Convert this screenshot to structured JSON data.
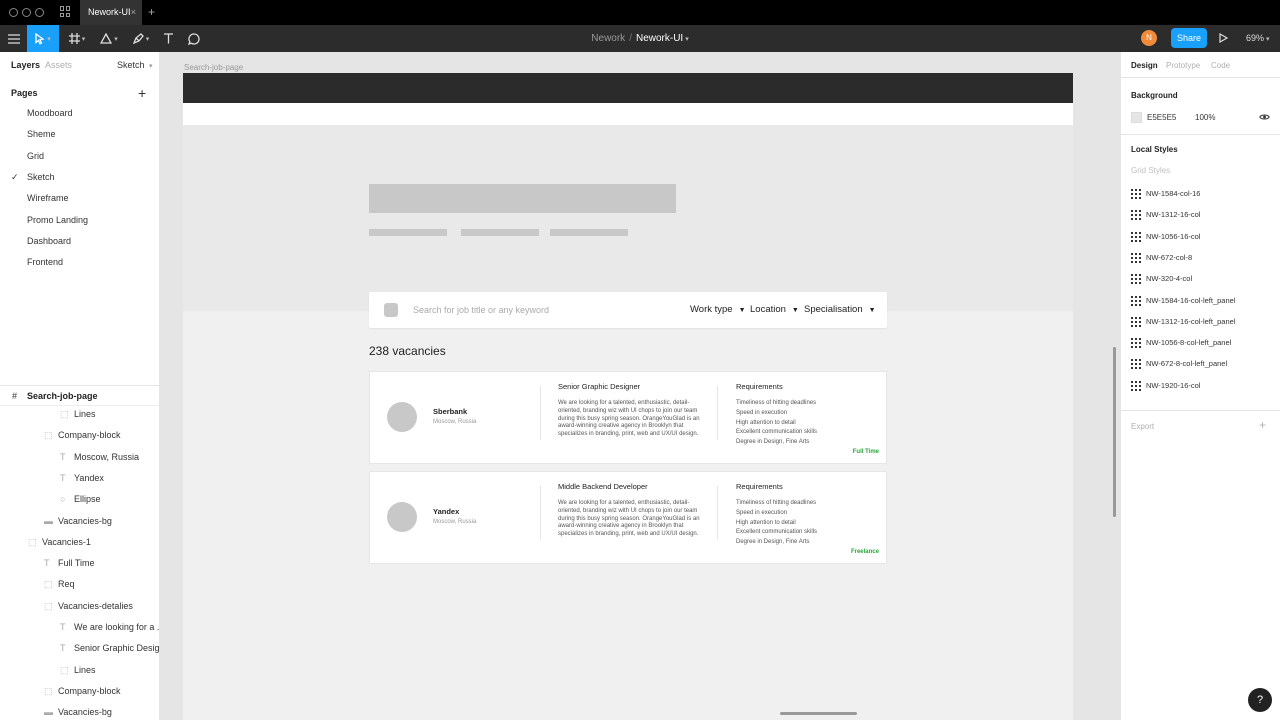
{
  "window": {
    "tab_title": "Nework-UI",
    "tab_close": "×",
    "tab_add": "+"
  },
  "toolbar": {
    "tools": [
      "move-tool",
      "frame-tool",
      "shape-tool",
      "pen-tool",
      "text-tool",
      "comment-tool"
    ],
    "file_path": {
      "team": "Nework",
      "separator": "/",
      "file": "Nework-UI"
    },
    "avatar_initial": "N",
    "share_label": "Share",
    "zoom": "69%",
    "accent_color": "#18a0fb"
  },
  "left_panel": {
    "tabs": {
      "layers": "Layers",
      "assets": "Assets",
      "page_selector": "Sketch"
    },
    "pages_title": "Pages",
    "pages_add": "+",
    "pages": [
      {
        "label": "Moodboard",
        "active": false
      },
      {
        "label": "Sheme",
        "active": false
      },
      {
        "label": "Grid",
        "active": false
      },
      {
        "label": "Sketch",
        "active": true
      },
      {
        "label": "Wireframe",
        "active": false
      },
      {
        "label": "Promo Landing",
        "active": false
      },
      {
        "label": "Dashboard",
        "active": false
      },
      {
        "label": "Frontend",
        "active": false
      }
    ],
    "current_frame": "Search-job-page",
    "layers": [
      {
        "label": "Lines",
        "icon": "group-icon",
        "depth": 3
      },
      {
        "label": "Company-block",
        "icon": "group-icon",
        "depth": 2
      },
      {
        "label": "Moscow, Russia",
        "icon": "text-icon",
        "depth": 3
      },
      {
        "label": "Yandex",
        "icon": "text-icon",
        "depth": 3
      },
      {
        "label": "Ellipse",
        "icon": "ellipse-icon",
        "depth": 3
      },
      {
        "label": "Vacancies-bg",
        "icon": "rectangle-icon",
        "depth": 2
      },
      {
        "label": "Vacancies-1",
        "icon": "group-icon",
        "depth": 1
      },
      {
        "label": "Full Time",
        "icon": "text-icon",
        "depth": 2
      },
      {
        "label": "Req",
        "icon": "group-icon",
        "depth": 2
      },
      {
        "label": "Vacancies-detalies",
        "icon": "group-icon",
        "depth": 2
      },
      {
        "label": "We are looking for a ...",
        "icon": "text-icon",
        "depth": 3
      },
      {
        "label": "Senior Graphic Desig...",
        "icon": "text-icon",
        "depth": 3
      },
      {
        "label": "Lines",
        "icon": "group-icon",
        "depth": 3
      },
      {
        "label": "Company-block",
        "icon": "group-icon",
        "depth": 2
      },
      {
        "label": "Vacancies-bg",
        "icon": "rectangle-icon",
        "depth": 2
      }
    ]
  },
  "canvas": {
    "frame_label": "Search-job-page",
    "search": {
      "placeholder": "Search for job title or any keyword",
      "filters": [
        "Work type",
        "Location",
        "Specialisation"
      ],
      "filter_arrow": "▼"
    },
    "vacancies_count": "238 vacancies",
    "cards": [
      {
        "company": "Sberbank",
        "location": "Moscow, Russia",
        "job_title": "Senior Graphic Designer",
        "description": "We are looking for a talented, enthusiastic, detail-oriented, branding wiz with UI chops to join our team during this busy spring season. OrangeYouGlad is an award-winning creative agency in Brooklyn that specializes in branding, print, web and UX/UI design.",
        "requirements_title": "Requirements",
        "requirements": [
          "Timeliness of hitting deadlines",
          "Speed in execution",
          "High attention to detail",
          "Excellent communication skills",
          "Degree in Design, Fine Arts"
        ],
        "job_type": "Full Time"
      },
      {
        "company": "Yandex",
        "location": "Moscow, Russia",
        "job_title": "Middle Backend Developer",
        "description": "We are looking for a talented, enthusiastic, detail-oriented, branding wiz with UI chops to join our team during this busy spring season. OrangeYouGlad is an award-winning creative agency in Brooklyn that specializes in branding, print, web and UX/UI design.",
        "requirements_title": "Requirements",
        "requirements": [
          "Timeliness of hitting deadlines",
          "Speed in execution",
          "High attention to detail",
          "Excellent communication skills",
          "Degree in Design, Fine Arts"
        ],
        "job_type": "Freelance"
      }
    ],
    "job_type_color": "#2aa63b"
  },
  "right_panel": {
    "tabs": {
      "design": "Design",
      "prototype": "Prototype",
      "code": "Code"
    },
    "background": {
      "title": "Background",
      "hex": "E5E5E5",
      "opacity": "100%",
      "color": "#e5e5e5"
    },
    "local_styles_title": "Local Styles",
    "grid_styles_title": "Grid Styles",
    "grid_styles": [
      "NW-1584-col-16",
      "NW-1312-16-col",
      "NW-1056-16-col",
      "NW-672-col-8",
      "NW-320-4-col",
      "NW-1584-16-col-left_panel",
      "NW-1312-16-col-left_panel",
      "NW-1056-8-col-left_panel",
      "NW-672-8-col-left_panel",
      "NW-1920-16-col"
    ],
    "export_title": "Export",
    "export_add": "+"
  },
  "help_label": "?"
}
